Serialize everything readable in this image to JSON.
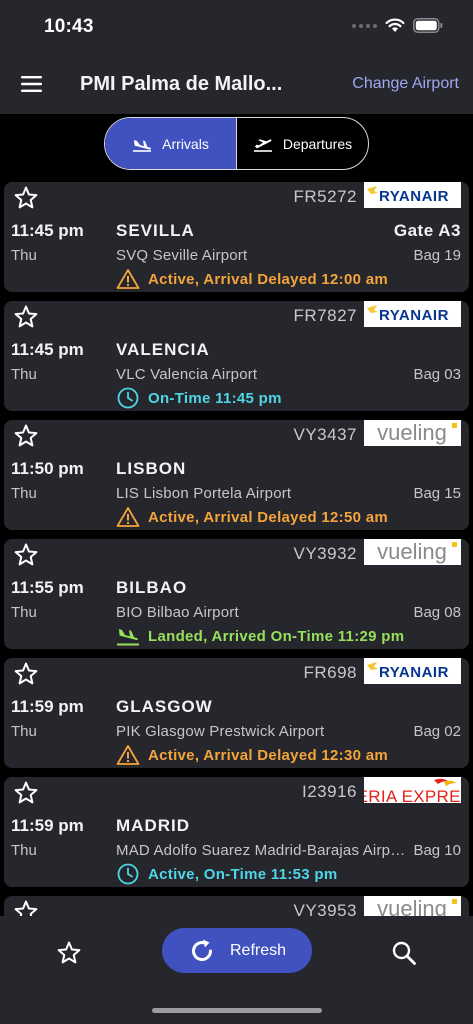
{
  "status_bar": {
    "time": "10:43"
  },
  "header": {
    "title": "PMI Palma de Mallo...",
    "change_airport": "Change Airport"
  },
  "tabs": {
    "arrivals": "Arrivals",
    "departures": "Departures"
  },
  "colors": {
    "accent": "#3f52c0",
    "delayed": "#f3a43b",
    "ontime": "#4fd6e6",
    "landed": "#98e05a",
    "link": "#9ea7ee"
  },
  "flights": [
    {
      "flight_no": "FR5272",
      "airline": "RYANAIR",
      "time": "11:45 pm",
      "day": "Thu",
      "city": "SEVILLA",
      "airport": "SVQ Seville Airport",
      "gate": "Gate A3",
      "bag": "Bag 19",
      "status": "Active, Arrival Delayed 12:00 am",
      "status_type": "delayed"
    },
    {
      "flight_no": "FR7827",
      "airline": "RYANAIR",
      "time": "11:45 pm",
      "day": "Thu",
      "city": "VALENCIA",
      "airport": "VLC Valencia Airport",
      "gate": "",
      "bag": "Bag 03",
      "status": "On-Time 11:45 pm",
      "status_type": "ontime"
    },
    {
      "flight_no": "VY3437",
      "airline": "vueling",
      "time": "11:50 pm",
      "day": "Thu",
      "city": "LISBON",
      "airport": "LIS Lisbon Portela Airport",
      "gate": "",
      "bag": "Bag 15",
      "status": "Active, Arrival Delayed 12:50 am",
      "status_type": "delayed"
    },
    {
      "flight_no": "VY3932",
      "airline": "vueling",
      "time": "11:55 pm",
      "day": "Thu",
      "city": "BILBAO",
      "airport": "BIO Bilbao Airport",
      "gate": "",
      "bag": "Bag 08",
      "status": "Landed, Arrived On-Time 11:29 pm",
      "status_type": "landed"
    },
    {
      "flight_no": "FR698",
      "airline": "RYANAIR",
      "time": "11:59 pm",
      "day": "Thu",
      "city": "GLASGOW",
      "airport": "PIK Glasgow Prestwick Airport",
      "gate": "",
      "bag": "Bag 02",
      "status": "Active, Arrival Delayed 12:30 am",
      "status_type": "delayed"
    },
    {
      "flight_no": "I23916",
      "airline": "IBERIA EXPRESS",
      "time": "11:59 pm",
      "day": "Thu",
      "city": "MADRID",
      "airport": "MAD Adolfo Suarez Madrid-Barajas Airport",
      "gate": "",
      "bag": "Bag 10",
      "status": "Active, On-Time 11:53 pm",
      "status_type": "ontime"
    },
    {
      "flight_no": "VY3953",
      "airline": "vueling",
      "time": "",
      "day": "",
      "city": "",
      "airport": "",
      "gate": "",
      "bag": "",
      "status": "",
      "status_type": "none"
    }
  ],
  "tab_bar": {
    "refresh": "Refresh"
  }
}
